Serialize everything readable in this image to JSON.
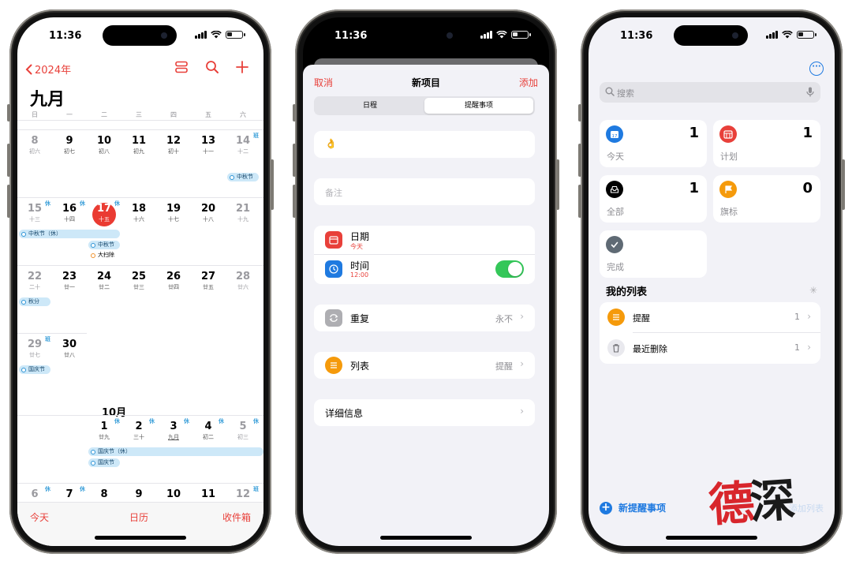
{
  "status": {
    "time": "11:36"
  },
  "calendar": {
    "back_label": "2024年",
    "month_title": "九月",
    "weekdays": [
      "日",
      "一",
      "二",
      "三",
      "四",
      "五",
      "六"
    ],
    "week1": [
      {
        "n": "8",
        "l": "初六"
      },
      {
        "n": "9",
        "l": "初七"
      },
      {
        "n": "10",
        "l": "初八"
      },
      {
        "n": "11",
        "l": "初九"
      },
      {
        "n": "12",
        "l": "初十"
      },
      {
        "n": "13",
        "l": "十一"
      },
      {
        "n": "14",
        "l": "十二",
        "tag": "班"
      }
    ],
    "week2": [
      {
        "n": "15",
        "l": "十三",
        "tag": "休"
      },
      {
        "n": "16",
        "l": "十四",
        "tag": "休"
      },
      {
        "n": "17",
        "l": "十五",
        "tag": "休"
      },
      {
        "n": "18",
        "l": "十六"
      },
      {
        "n": "19",
        "l": "十七"
      },
      {
        "n": "20",
        "l": "十八"
      },
      {
        "n": "21",
        "l": "十九"
      }
    ],
    "week3": [
      {
        "n": "22",
        "l": "二十"
      },
      {
        "n": "23",
        "l": "廿一"
      },
      {
        "n": "24",
        "l": "廿二"
      },
      {
        "n": "25",
        "l": "廿三"
      },
      {
        "n": "26",
        "l": "廿四"
      },
      {
        "n": "27",
        "l": "廿五"
      },
      {
        "n": "28",
        "l": "廿六"
      }
    ],
    "week4": [
      {
        "n": "29",
        "l": "廿七",
        "tag": "班"
      },
      {
        "n": "30",
        "l": "廿八"
      }
    ],
    "october_title": "10月",
    "week5": [
      {
        "n": "1",
        "l": "廿九",
        "tag": "休"
      },
      {
        "n": "2",
        "l": "三十",
        "tag": "休"
      },
      {
        "n": "3",
        "l": "九月",
        "tag": "休"
      },
      {
        "n": "4",
        "l": "初二",
        "tag": "休"
      },
      {
        "n": "5",
        "l": "初三",
        "tag": "休"
      }
    ],
    "week6": [
      {
        "n": "6",
        "l": "",
        "tag": "休"
      },
      {
        "n": "7",
        "l": "",
        "tag": "休"
      },
      {
        "n": "8",
        "l": ""
      },
      {
        "n": "9",
        "l": ""
      },
      {
        "n": "10",
        "l": ""
      },
      {
        "n": "11",
        "l": ""
      },
      {
        "n": "12",
        "l": "",
        "tag": "班"
      }
    ],
    "events": {
      "midautumn": "中秋节",
      "midautumn_holiday": "中秋节（休）",
      "cleaning": "大扫除",
      "autumn_equinox": "秋分",
      "national_day": "国庆节",
      "national_day_holiday": "国庆节（休）"
    },
    "tabbar": {
      "today": "今天",
      "calendars": "日历",
      "inbox": "收件箱"
    },
    "accent": "#e8403a"
  },
  "new_item": {
    "cancel": "取消",
    "title": "新项目",
    "add": "添加",
    "seg_event": "日程",
    "seg_reminder": "提醒事项",
    "title_emoji": "👌",
    "notes_placeholder": "备注",
    "date_label": "日期",
    "date_value": "今天",
    "time_label": "时间",
    "time_value": "12:00",
    "repeat_label": "重复",
    "repeat_value": "永不",
    "list_label": "列表",
    "list_value": "提醒",
    "details_label": "详细信息"
  },
  "reminders": {
    "search_placeholder": "搜索",
    "tiles": {
      "today": {
        "label": "今天",
        "count": "1",
        "color": "#1f7ae0"
      },
      "scheduled": {
        "label": "计划",
        "count": "1",
        "color": "#e8403a"
      },
      "all": {
        "label": "全部",
        "count": "1",
        "color": "#000000"
      },
      "flagged": {
        "label": "旗标",
        "count": "0",
        "color": "#f59a0b"
      },
      "completed": {
        "label": "完成",
        "color": "#5f6a74"
      }
    },
    "my_lists_title": "我的列表",
    "lists": [
      {
        "label": "提醒",
        "count": "1"
      },
      {
        "label": "最近删除",
        "count": "1"
      }
    ],
    "new_reminder": "新提醒事项",
    "add_list": "添加列表"
  },
  "watermark": {
    "text1": "德",
    "text2": "深"
  }
}
